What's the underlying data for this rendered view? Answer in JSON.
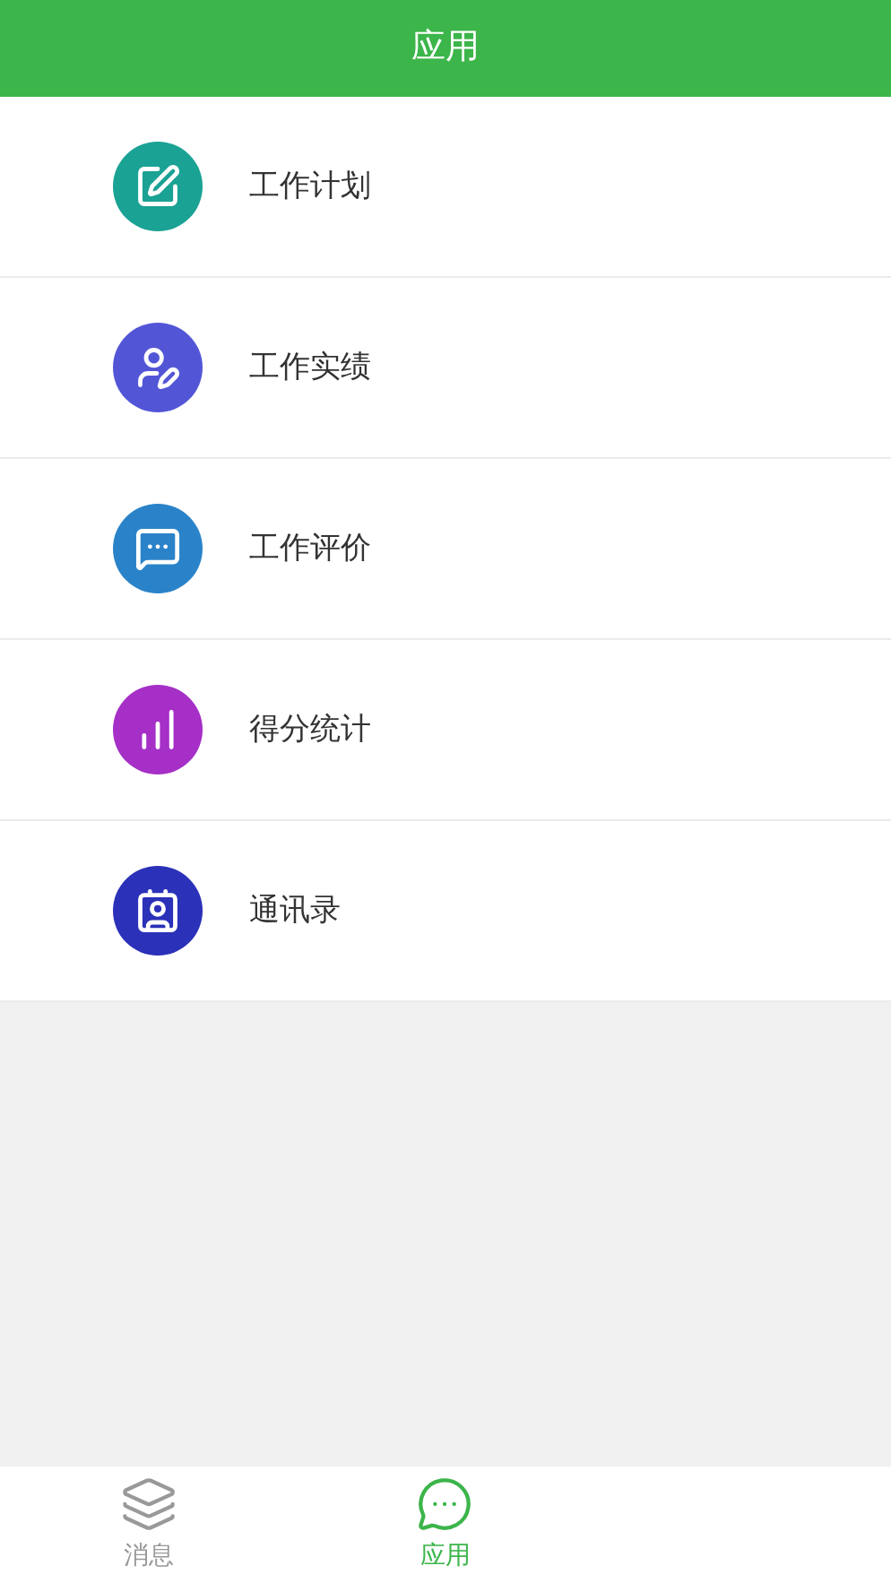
{
  "header": {
    "title": "应用"
  },
  "apps": [
    {
      "label": "工作计划",
      "kind": "edit",
      "color": "#1aa294"
    },
    {
      "label": "工作实绩",
      "kind": "user-edit",
      "color": "#5256d6"
    },
    {
      "label": "工作评价",
      "kind": "chat",
      "color": "#2a83c9"
    },
    {
      "label": "得分统计",
      "kind": "chart",
      "color": "#a52fc7"
    },
    {
      "label": "通讯录",
      "kind": "contacts",
      "color": "#2b31b8"
    }
  ],
  "tab_bar": [
    {
      "label": "消息",
      "kind": "layers",
      "selected": false
    },
    {
      "label": "应用",
      "kind": "chat",
      "selected": true
    }
  ]
}
